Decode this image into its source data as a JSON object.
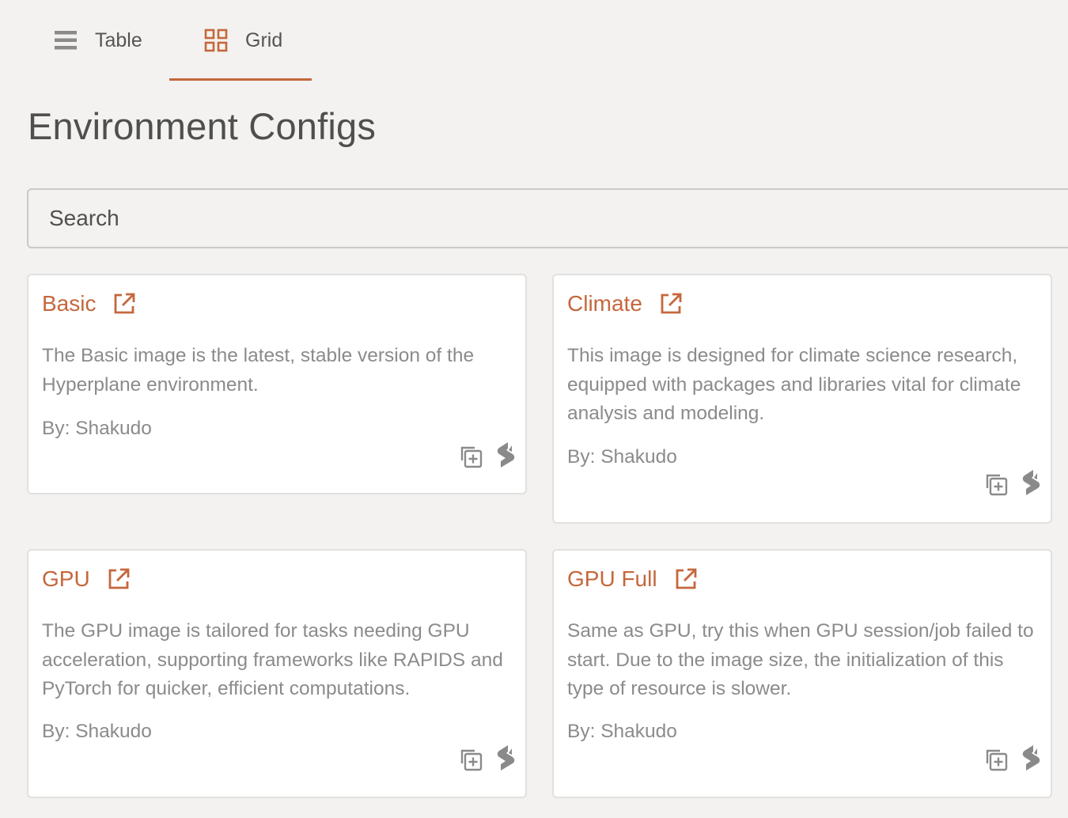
{
  "tabs": [
    {
      "label": "Table",
      "icon": "list-icon",
      "active": false
    },
    {
      "label": "Grid",
      "icon": "grid-icon",
      "active": true
    }
  ],
  "page_title": "Environment Configs",
  "search": {
    "placeholder": "Search",
    "value": ""
  },
  "colors": {
    "accent": "#c5673c",
    "background": "#f3f2f0",
    "card": "#ffffff",
    "muted_text": "#8b8b8b"
  },
  "cards": [
    {
      "title": "Basic",
      "description": "The Basic image is the latest, stable version of the Hyperplane environment.",
      "author": "By: Shakudo"
    },
    {
      "title": "Climate",
      "description": "This image is designed for climate science research, equipped with packages and libraries vital for climate analysis and modeling.",
      "author": "By: Shakudo"
    },
    {
      "title": "GPU",
      "description": "The GPU image is tailored for tasks needing GPU acceleration, supporting frameworks like RAPIDS and PyTorch for quicker, efficient computations.",
      "author": "By: Shakudo"
    },
    {
      "title": "GPU Full",
      "description": "Same as GPU, try this when GPU session/job failed to start. Due to the image size, the initialization of this type of resource is slower.",
      "author": "By: Shakudo"
    }
  ],
  "icons": {
    "title_link": "external-link-icon",
    "duplicate": "copy-plus-icon",
    "brand": "shakudo-logo-icon"
  }
}
